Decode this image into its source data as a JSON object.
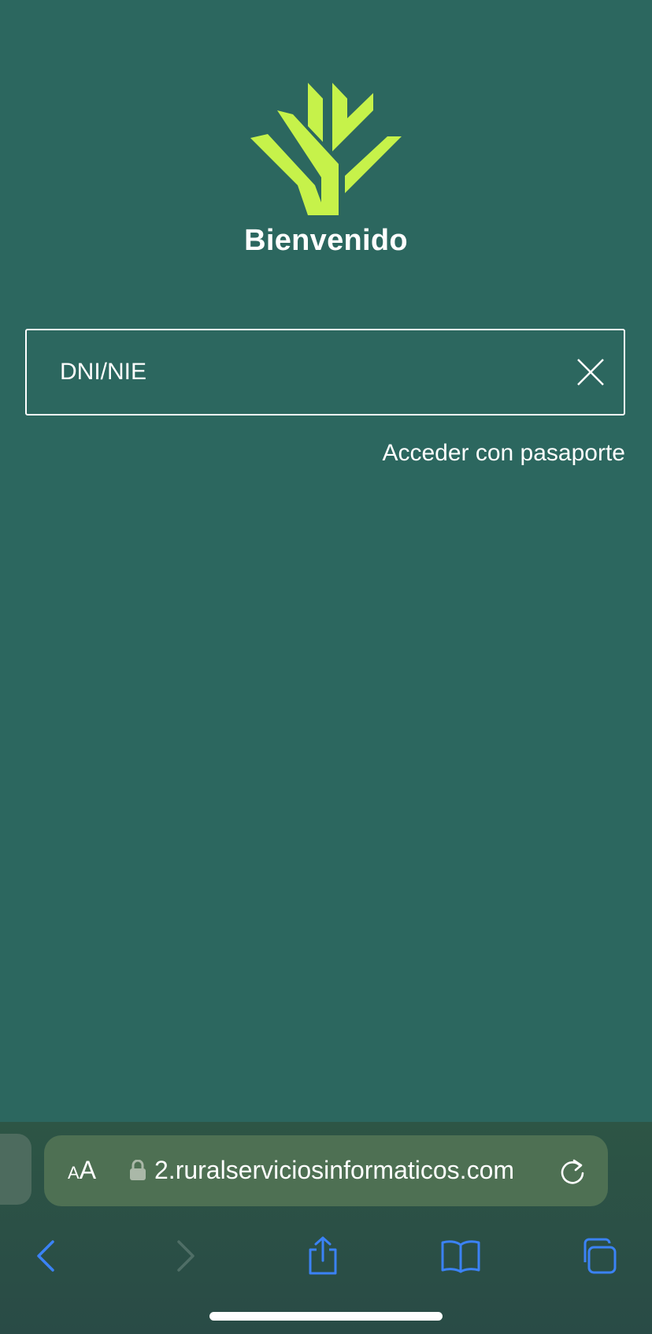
{
  "app": {
    "welcome_title": "Bienvenido",
    "brand_color": "#c6f24a",
    "background_color": "#2c675f"
  },
  "login": {
    "id_placeholder": "DNI/NIE",
    "id_value": "",
    "passport_link": "Acceder con pasaporte"
  },
  "browser": {
    "text_size_label_small": "A",
    "text_size_label_large": "A",
    "url": "2.ruralserviciosinformaticos.com",
    "icons": {
      "lock": "lock-icon",
      "reload": "reload-icon",
      "back": "chevron-left-icon",
      "forward": "chevron-right-icon",
      "share": "share-icon",
      "bookmarks": "book-icon",
      "tabs": "tabs-icon"
    },
    "accent_color": "#3b82f6"
  }
}
